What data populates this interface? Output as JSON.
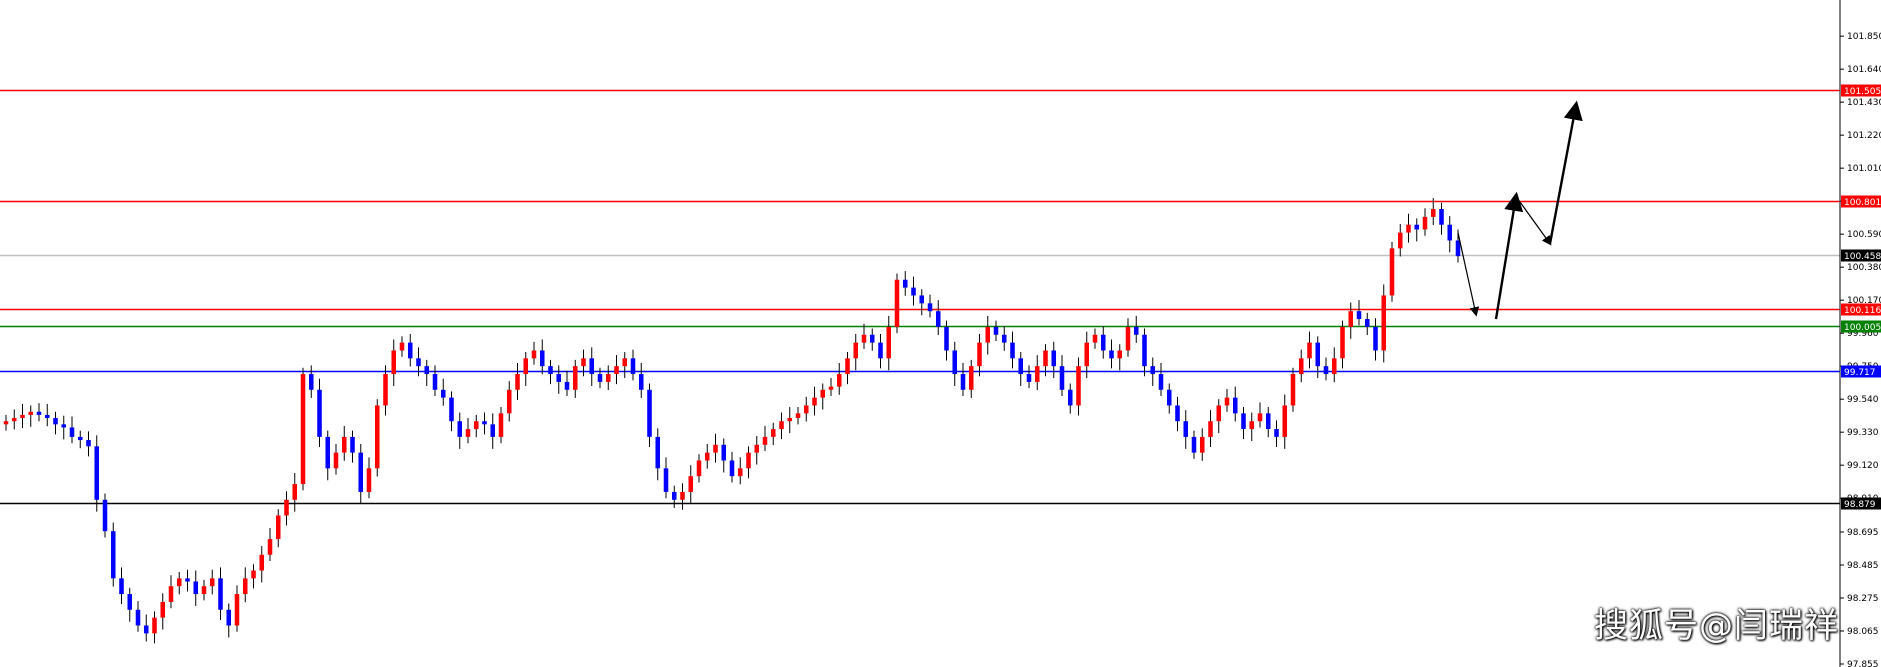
{
  "chart_data": {
    "type": "candlestick",
    "title": "",
    "xlabel": "",
    "ylabel": "",
    "ylim": [
      97.855,
      102.08
    ],
    "y_ticks": [
      "101.850",
      "101.640",
      "101.430",
      "101.220",
      "101.010",
      "100.800",
      "100.590",
      "100.380",
      "100.170",
      "99.960",
      "99.750",
      "99.540",
      "99.330",
      "99.120",
      "98.910",
      "98.695",
      "98.485",
      "98.275",
      "98.065",
      "97.855"
    ],
    "colors": {
      "up": "#ff0000",
      "down": "#0000ff",
      "wick": "#000000",
      "projection": "#000000"
    },
    "levels": [
      {
        "label": "101.505",
        "value": 101.505,
        "color": "#ff0000"
      },
      {
        "label": "100.801",
        "value": 100.801,
        "color": "#ff0000"
      },
      {
        "label": "100.458",
        "value": 100.458,
        "color": "#c0c0c0",
        "tag_color": "#000000"
      },
      {
        "label": "100.116",
        "value": 100.116,
        "color": "#ff0000"
      },
      {
        "label": "100.005",
        "value": 100.005,
        "color": "#008000"
      },
      {
        "label": "99.717",
        "value": 99.717,
        "color": "#0000ff"
      },
      {
        "label": "98.879",
        "value": 98.879,
        "color": "#000000"
      }
    ],
    "series": [
      {
        "closes": [
          99.4,
          99.42,
          99.44,
          99.46,
          99.44,
          99.42,
          99.38,
          99.36,
          99.3,
          99.28,
          99.24,
          98.9,
          98.7,
          98.4,
          98.3,
          98.2,
          98.1,
          98.05,
          98.15,
          98.25,
          98.35,
          98.4,
          98.38,
          98.3,
          98.35,
          98.4,
          98.2,
          98.1,
          98.3,
          98.4,
          98.45,
          98.55,
          98.65,
          98.8,
          98.9,
          99.0,
          99.7,
          99.6,
          99.3,
          99.1,
          99.2,
          99.3,
          99.2,
          98.95,
          99.1,
          99.5,
          99.7,
          99.85,
          99.9,
          99.8,
          99.75,
          99.7,
          99.6,
          99.55,
          99.4,
          99.3,
          99.35,
          99.4,
          99.38,
          99.3,
          99.45,
          99.6,
          99.7,
          99.8,
          99.85,
          99.75,
          99.7,
          99.65,
          99.6,
          99.75,
          99.8,
          99.7,
          99.65,
          99.7,
          99.75,
          99.8,
          99.7,
          99.6,
          99.3,
          99.1,
          98.95,
          98.9,
          98.95,
          99.05,
          99.15,
          99.2,
          99.25,
          99.15,
          99.05,
          99.1,
          99.2,
          99.25,
          99.3,
          99.35,
          99.4,
          99.42,
          99.45,
          99.5,
          99.55,
          99.6,
          99.62,
          99.7,
          99.8,
          99.9,
          99.95,
          99.9,
          99.8,
          100.0,
          100.3,
          100.25,
          100.2,
          100.15,
          100.1,
          100.0,
          99.85,
          99.7,
          99.6,
          99.75,
          99.9,
          100.0,
          99.95,
          99.9,
          99.8,
          99.7,
          99.65,
          99.75,
          99.85,
          99.75,
          99.6,
          99.5,
          99.75,
          99.9,
          99.95,
          99.85,
          99.8,
          99.85,
          100.0,
          99.95,
          99.75,
          99.7,
          99.6,
          99.5,
          99.4,
          99.3,
          99.2,
          99.3,
          99.4,
          99.5,
          99.55,
          99.45,
          99.35,
          99.4,
          99.45,
          99.35,
          99.3,
          99.5,
          99.7,
          99.8,
          99.9,
          99.75,
          99.7,
          99.8,
          100.0,
          100.1,
          100.05,
          100.0,
          99.85,
          100.2,
          100.5,
          100.6,
          100.65,
          100.62,
          100.7,
          100.75,
          100.65,
          100.55,
          100.45
        ]
      }
    ],
    "projection": [
      {
        "from": 100.6,
        "to": 100.08
      },
      {
        "from": 100.05,
        "to": 100.83
      },
      {
        "from": 100.83,
        "to": 100.53
      },
      {
        "from": 100.53,
        "to": 101.41
      }
    ]
  },
  "watermark": "搜狐号@闫瑞祥"
}
